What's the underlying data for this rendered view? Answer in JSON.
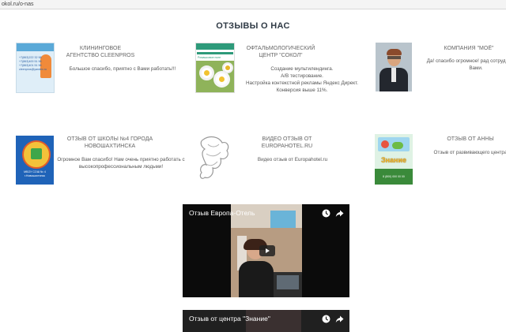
{
  "browser": {
    "url": "okol.ru/o-nas"
  },
  "page": {
    "title": "ОТЗЫВЫ О НАС"
  },
  "cards": [
    {
      "title": "КЛИНИНГОВОЕ АГЕНТСТВО CLEENPROS",
      "text": "Большое спасибо, приятно с Вами работать!!!",
      "thumb_text": [
        "+7(863)222 32 98",
        "+7(863)400 51 98",
        "+7(863)401 51 98",
        "cleenpros@yandex.ru"
      ]
    },
    {
      "title": "ОФТАЛЬМОЛОГИЧЕСКИЙ ЦЕНТР \"СОКОЛ\"",
      "text": "Создание мультилендинга.\nA/B тестирование.\nНастройка контекстной рекламы Яндекс Директ.\nКонверсия выше 11%.",
      "thumb_text": "Ромашковое поле"
    },
    {
      "title": "КОМПАНИЯ \"МОЁ\"",
      "text": "Да! спасибо огромное! рад сотрудничать с Вами."
    },
    {
      "title": "ОТЗЫВ ОТ ШКОЛЫ №4 ГОРОДА НОВОШАХТИНСКА",
      "text": "Огромное Вам спасибо! Нам очень приятно работать с высокопрофессиональным людьми!",
      "thumb_text": [
        "МБОУ СОШ № 4",
        "г.Новошахтинск"
      ]
    },
    {
      "title": "ВИДЕО ОТЗЫВ ОТ EUROPAHOTEL.RU",
      "text": "Видео отзыв от Europahotel.ru"
    },
    {
      "title": "ОТЗЫВ ОТ АННЫ",
      "text": "Отзыв от развивающего центра",
      "thumb_text": [
        "Знание",
        "8 (800) 000 00 00"
      ]
    }
  ],
  "videos": [
    {
      "title": "Отзыв Европа-Отель"
    },
    {
      "title": "Отзыв от центра \"Знание\""
    }
  ],
  "colors": {
    "title": "#2f3a45",
    "video_bg": "#0b0b0b",
    "text": "#555555"
  }
}
